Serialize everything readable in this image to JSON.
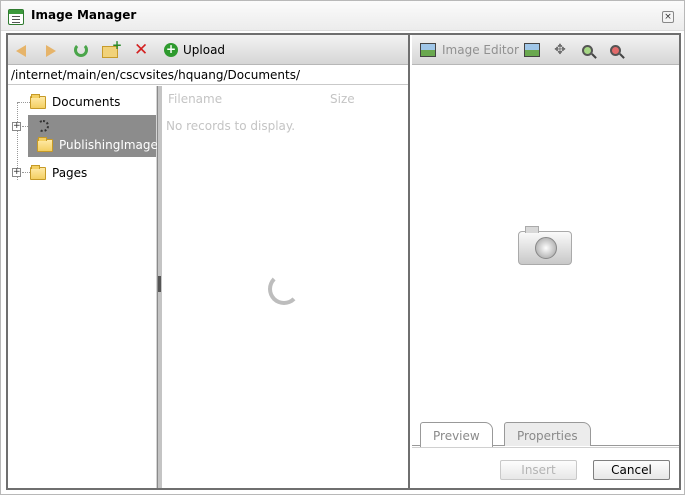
{
  "window": {
    "title": "Image Manager",
    "close_icon": "close-icon"
  },
  "toolbar": {
    "back_icon": "back-arrow-icon",
    "forward_icon": "forward-arrow-icon",
    "refresh_icon": "refresh-icon",
    "new_folder_icon": "new-folder-icon",
    "delete_icon": "delete-icon",
    "upload_label": "Upload"
  },
  "path": "/internet/main/en/cscvsites/hquang/Documents/",
  "tree": {
    "items": [
      {
        "label": "Documents"
      },
      {
        "label": "PublishingImages"
      },
      {
        "label": "Pages"
      }
    ]
  },
  "file_list": {
    "columns": [
      "Filename",
      "Size"
    ],
    "empty_text": "No records to display."
  },
  "preview_toolbar": {
    "image_editor_label": "Image Editor"
  },
  "tabs": [
    "Preview",
    "Properties"
  ],
  "buttons": {
    "insert": "Insert",
    "cancel": "Cancel"
  },
  "colors": {
    "frame_border": "#6f6f6f",
    "selected_bg": "#8c8c8c",
    "accent_green": "#2e9a2e",
    "delete_red": "#d32020"
  }
}
